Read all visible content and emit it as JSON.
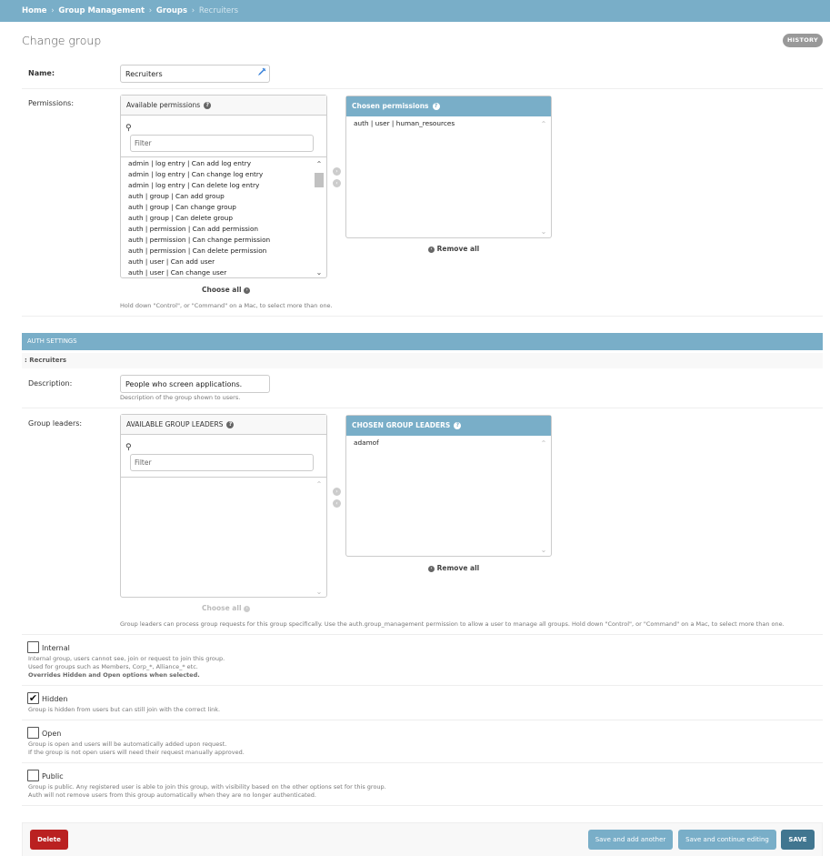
{
  "breadcrumbs": {
    "home": "Home",
    "group_management": "Group Management",
    "groups": "Groups",
    "current": "Recruiters",
    "separator": "›"
  },
  "page": {
    "title": "Change group",
    "history": "HISTORY"
  },
  "name_field": {
    "label": "Name:",
    "value": "Recruiters"
  },
  "permissions": {
    "label": "Permissions:",
    "available_title": "Available permissions",
    "filter_placeholder": "Filter",
    "available": [
      "admin | log entry | Can add log entry",
      "admin | log entry | Can change log entry",
      "admin | log entry | Can delete log entry",
      "auth | group | Can add group",
      "auth | group | Can change group",
      "auth | group | Can delete group",
      "auth | permission | Can add permission",
      "auth | permission | Can change permission",
      "auth | permission | Can delete permission",
      "auth | user | Can add user",
      "auth | user | Can change user"
    ],
    "chosen_title": "Chosen permissions",
    "chosen": [
      "auth | user | human_resources"
    ],
    "choose_all": "Choose all",
    "remove_all": "Remove all",
    "help": "Hold down \"Control\", or \"Command\" on a Mac, to select more than one."
  },
  "auth_settings": {
    "header": "AUTH SETTINGS",
    "subheader": ": Recruiters",
    "description": {
      "label": "Description:",
      "value": "People who screen applications.",
      "help": "Description of the group shown to users."
    },
    "group_leaders": {
      "label": "Group leaders:",
      "available_title": "AVAILABLE GROUP LEADERS",
      "filter_placeholder": "Filter",
      "chosen_title": "CHOSEN GROUP LEADERS",
      "chosen": [
        "adamof"
      ],
      "choose_all": "Choose all",
      "remove_all": "Remove all",
      "help": "Group leaders can process group requests for this group specifically. Use the auth.group_management permission to allow a user to manage all groups. Hold down \"Control\", or \"Command\" on a Mac, to select more than one."
    },
    "internal": {
      "label": "Internal",
      "checked": false,
      "help1": "Internal group, users cannot see, join or request to join this group.",
      "help2": "Used for groups such as Members, Corp_*, Alliance_* etc.",
      "help3": "Overrides Hidden and Open options when selected."
    },
    "hidden": {
      "label": "Hidden",
      "checked": true,
      "help1": "Group is hidden from users but can still join with the correct link."
    },
    "open": {
      "label": "Open",
      "checked": false,
      "help1": "Group is open and users will be automatically added upon request.",
      "help2": "If the group is not open users will need their request manually approved."
    },
    "public": {
      "label": "Public",
      "checked": false,
      "help1": "Group is public. Any registered user is able to join this group, with visibility based on the other options set for this group.",
      "help2": "Auth will not remove users from this group automatically when they are no longer authenticated."
    }
  },
  "submit": {
    "delete": "Delete",
    "save_add_another": "Save and add another",
    "save_continue": "Save and continue editing",
    "save": "SAVE"
  },
  "icons": {
    "check": "✔",
    "search": "⚲",
    "up": "⌃",
    "down": "⌄",
    "arrow_right": "›",
    "arrow_left": "‹",
    "help": "?"
  },
  "colors": {
    "header": "#79aec8",
    "save": "#417690",
    "delete": "#ba2121"
  }
}
